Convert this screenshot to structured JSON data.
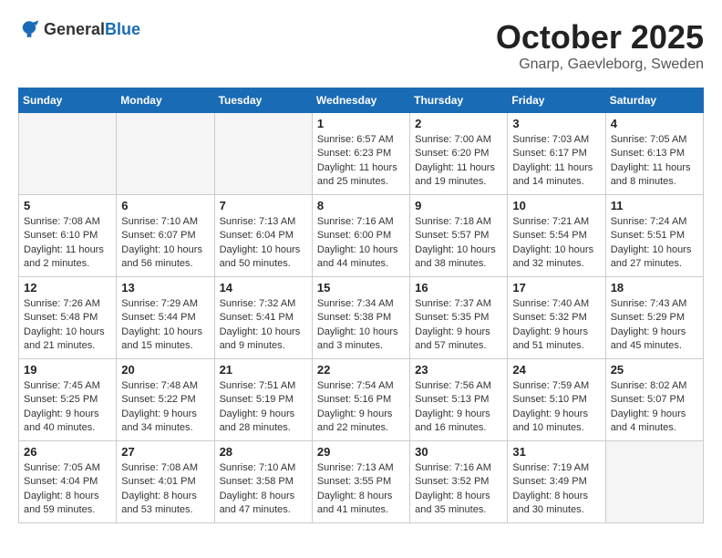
{
  "logo": {
    "general": "General",
    "blue": "Blue"
  },
  "title": "October 2025",
  "subtitle": "Gnarp, Gaevleborg, Sweden",
  "days": [
    "Sunday",
    "Monday",
    "Tuesday",
    "Wednesday",
    "Thursday",
    "Friday",
    "Saturday"
  ],
  "weeks": [
    [
      {
        "date": "",
        "content": ""
      },
      {
        "date": "",
        "content": ""
      },
      {
        "date": "",
        "content": ""
      },
      {
        "date": "1",
        "content": "Sunrise: 6:57 AM\nSunset: 6:23 PM\nDaylight: 11 hours\nand 25 minutes."
      },
      {
        "date": "2",
        "content": "Sunrise: 7:00 AM\nSunset: 6:20 PM\nDaylight: 11 hours\nand 19 minutes."
      },
      {
        "date": "3",
        "content": "Sunrise: 7:03 AM\nSunset: 6:17 PM\nDaylight: 11 hours\nand 14 minutes."
      },
      {
        "date": "4",
        "content": "Sunrise: 7:05 AM\nSunset: 6:13 PM\nDaylight: 11 hours\nand 8 minutes."
      }
    ],
    [
      {
        "date": "5",
        "content": "Sunrise: 7:08 AM\nSunset: 6:10 PM\nDaylight: 11 hours\nand 2 minutes."
      },
      {
        "date": "6",
        "content": "Sunrise: 7:10 AM\nSunset: 6:07 PM\nDaylight: 10 hours\nand 56 minutes."
      },
      {
        "date": "7",
        "content": "Sunrise: 7:13 AM\nSunset: 6:04 PM\nDaylight: 10 hours\nand 50 minutes."
      },
      {
        "date": "8",
        "content": "Sunrise: 7:16 AM\nSunset: 6:00 PM\nDaylight: 10 hours\nand 44 minutes."
      },
      {
        "date": "9",
        "content": "Sunrise: 7:18 AM\nSunset: 5:57 PM\nDaylight: 10 hours\nand 38 minutes."
      },
      {
        "date": "10",
        "content": "Sunrise: 7:21 AM\nSunset: 5:54 PM\nDaylight: 10 hours\nand 32 minutes."
      },
      {
        "date": "11",
        "content": "Sunrise: 7:24 AM\nSunset: 5:51 PM\nDaylight: 10 hours\nand 27 minutes."
      }
    ],
    [
      {
        "date": "12",
        "content": "Sunrise: 7:26 AM\nSunset: 5:48 PM\nDaylight: 10 hours\nand 21 minutes."
      },
      {
        "date": "13",
        "content": "Sunrise: 7:29 AM\nSunset: 5:44 PM\nDaylight: 10 hours\nand 15 minutes."
      },
      {
        "date": "14",
        "content": "Sunrise: 7:32 AM\nSunset: 5:41 PM\nDaylight: 10 hours\nand 9 minutes."
      },
      {
        "date": "15",
        "content": "Sunrise: 7:34 AM\nSunset: 5:38 PM\nDaylight: 10 hours\nand 3 minutes."
      },
      {
        "date": "16",
        "content": "Sunrise: 7:37 AM\nSunset: 5:35 PM\nDaylight: 9 hours\nand 57 minutes."
      },
      {
        "date": "17",
        "content": "Sunrise: 7:40 AM\nSunset: 5:32 PM\nDaylight: 9 hours\nand 51 minutes."
      },
      {
        "date": "18",
        "content": "Sunrise: 7:43 AM\nSunset: 5:29 PM\nDaylight: 9 hours\nand 45 minutes."
      }
    ],
    [
      {
        "date": "19",
        "content": "Sunrise: 7:45 AM\nSunset: 5:25 PM\nDaylight: 9 hours\nand 40 minutes."
      },
      {
        "date": "20",
        "content": "Sunrise: 7:48 AM\nSunset: 5:22 PM\nDaylight: 9 hours\nand 34 minutes."
      },
      {
        "date": "21",
        "content": "Sunrise: 7:51 AM\nSunset: 5:19 PM\nDaylight: 9 hours\nand 28 minutes."
      },
      {
        "date": "22",
        "content": "Sunrise: 7:54 AM\nSunset: 5:16 PM\nDaylight: 9 hours\nand 22 minutes."
      },
      {
        "date": "23",
        "content": "Sunrise: 7:56 AM\nSunset: 5:13 PM\nDaylight: 9 hours\nand 16 minutes."
      },
      {
        "date": "24",
        "content": "Sunrise: 7:59 AM\nSunset: 5:10 PM\nDaylight: 9 hours\nand 10 minutes."
      },
      {
        "date": "25",
        "content": "Sunrise: 8:02 AM\nSunset: 5:07 PM\nDaylight: 9 hours\nand 4 minutes."
      }
    ],
    [
      {
        "date": "26",
        "content": "Sunrise: 7:05 AM\nSunset: 4:04 PM\nDaylight: 8 hours\nand 59 minutes."
      },
      {
        "date": "27",
        "content": "Sunrise: 7:08 AM\nSunset: 4:01 PM\nDaylight: 8 hours\nand 53 minutes."
      },
      {
        "date": "28",
        "content": "Sunrise: 7:10 AM\nSunset: 3:58 PM\nDaylight: 8 hours\nand 47 minutes."
      },
      {
        "date": "29",
        "content": "Sunrise: 7:13 AM\nSunset: 3:55 PM\nDaylight: 8 hours\nand 41 minutes."
      },
      {
        "date": "30",
        "content": "Sunrise: 7:16 AM\nSunset: 3:52 PM\nDaylight: 8 hours\nand 35 minutes."
      },
      {
        "date": "31",
        "content": "Sunrise: 7:19 AM\nSunset: 3:49 PM\nDaylight: 8 hours\nand 30 minutes."
      },
      {
        "date": "",
        "content": ""
      }
    ]
  ]
}
